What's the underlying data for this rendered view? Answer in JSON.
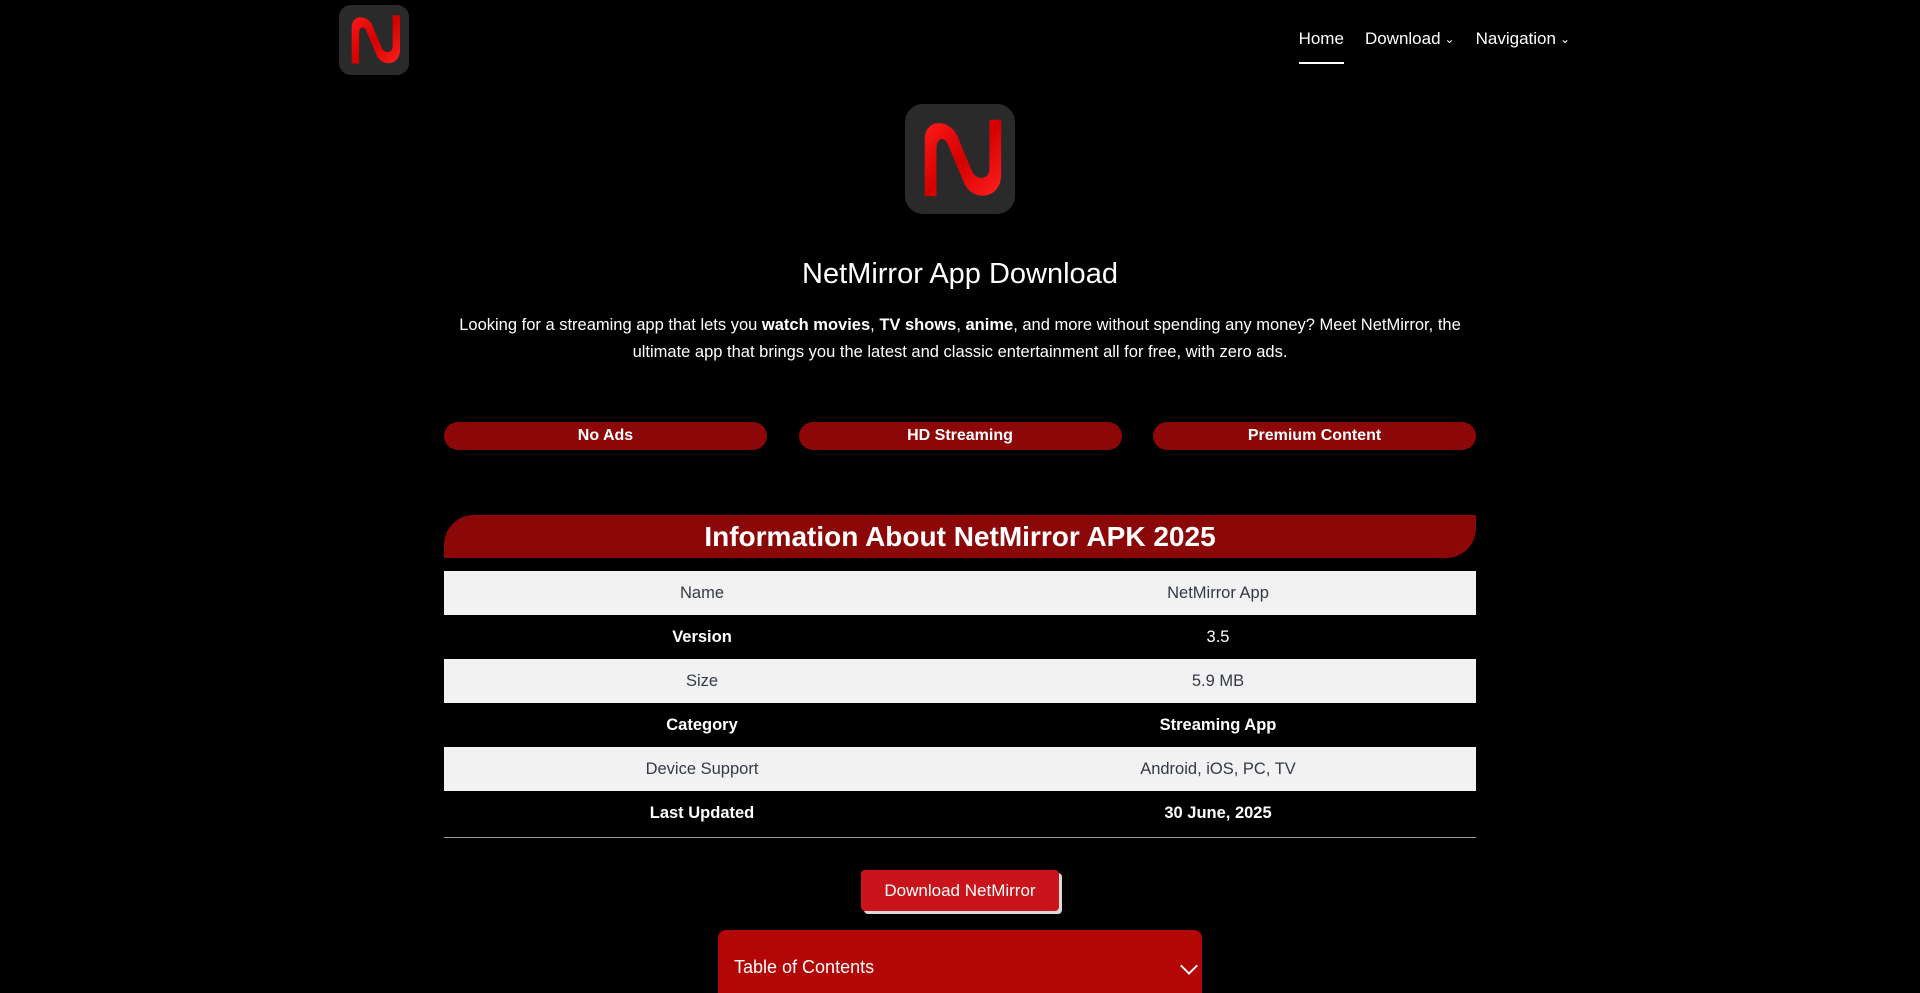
{
  "nav": {
    "items": [
      {
        "label": "Home",
        "dropdown": false,
        "active": true
      },
      {
        "label": "Download",
        "dropdown": true,
        "active": false
      },
      {
        "label": "Navigation",
        "dropdown": true,
        "active": false
      }
    ]
  },
  "hero": {
    "title": "NetMirror App Download",
    "intro": {
      "p1": "Looking for a streaming app that lets you ",
      "b1": "watch movies",
      "p2": ", ",
      "b2": "TV shows",
      "p3": ", ",
      "b3": "anime",
      "p4": ", and more without spending any money? Meet NetMirror, the ultimate app that brings you the latest and classic entertainment all for free, with zero ads."
    }
  },
  "features": [
    "No Ads",
    "HD Streaming",
    "Premium Content"
  ],
  "info": {
    "title": "Information About NetMirror APK 2025",
    "rows": [
      {
        "key": "Name",
        "value": "NetMirror App"
      },
      {
        "key": "Version",
        "value": "3.5"
      },
      {
        "key": "Size",
        "value": "5.9 MB"
      },
      {
        "key": "Category",
        "value": "Streaming App"
      },
      {
        "key": "Device Support",
        "value": "Android, iOS, PC, TV"
      },
      {
        "key": "Last Updated",
        "value": "30 June, 2025"
      }
    ]
  },
  "download": {
    "label": "Download NetMirror"
  },
  "toc": {
    "title": "Table of Contents"
  },
  "colors": {
    "accent_red": "#8c0808",
    "button_red": "#c8141a",
    "toc_red": "#b30606",
    "logo_red": "#e00000",
    "background": "#000000"
  },
  "icons": {
    "logo": "netmirror-n-logo",
    "chevron": "chevron-down-icon"
  }
}
